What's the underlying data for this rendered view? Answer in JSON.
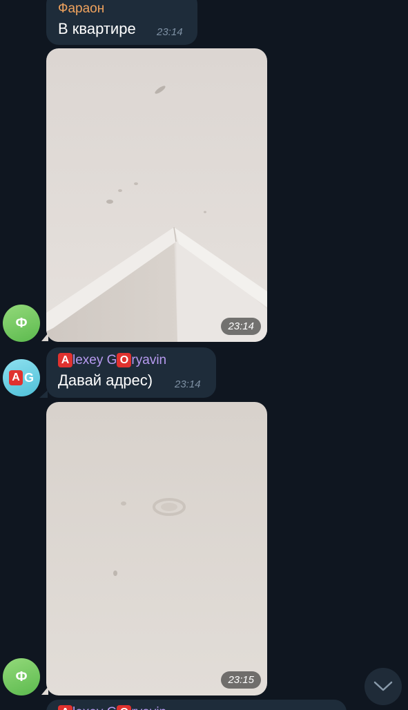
{
  "messages": [
    {
      "sender": "Фараон",
      "text": "В квартире",
      "time": "23:14"
    },
    {
      "photo_time": "23:14"
    },
    {
      "sender_box1": "A",
      "sender_mid": "lexey G",
      "sender_box2": "O",
      "sender_end": "ryavin",
      "text": "Давай адрес)",
      "time": "23:14"
    },
    {
      "photo_time": "23:15"
    }
  ],
  "avatars": {
    "faraon_initial": "Ф",
    "alexey_box": "A",
    "alexey_letter": "G"
  },
  "colors": {
    "background": "#0f1620",
    "bubble": "#1e2c3a",
    "sender_faraon": "#f0a35e",
    "sender_alexey": "#b79af0",
    "time": "#7f91a4"
  },
  "icons": {
    "scroll_down": "chevron-down-icon"
  }
}
